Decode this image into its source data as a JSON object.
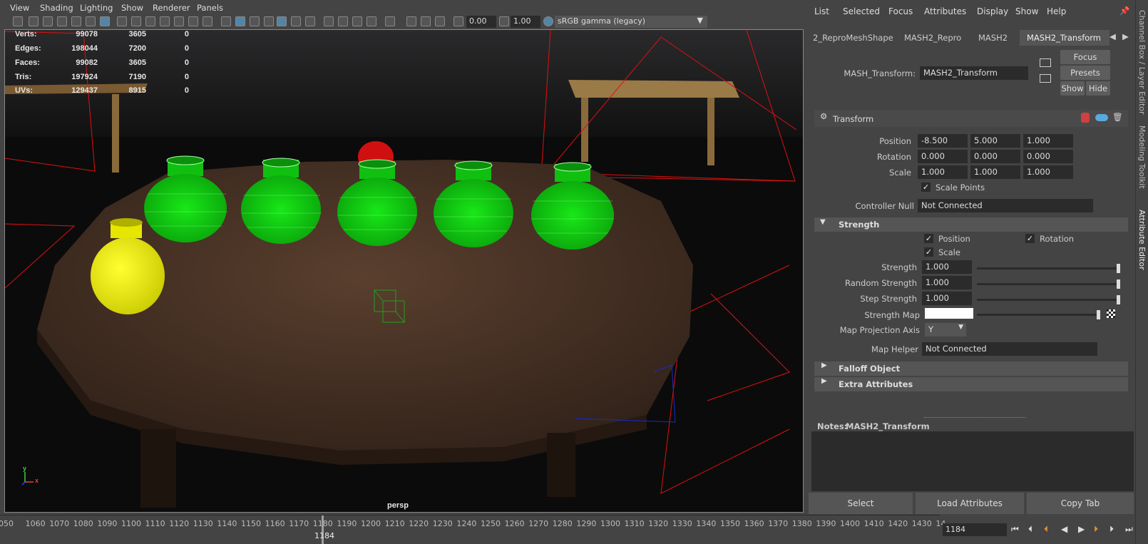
{
  "viewport_menu": [
    "View",
    "Shading",
    "Lighting",
    "Show",
    "Renderer",
    "Panels"
  ],
  "viewport_toolbar": {
    "exposure": "0.00",
    "gamma": "1.00",
    "color_space": "sRGB gamma (legacy)"
  },
  "hud": {
    "rows": [
      {
        "label": "Verts:",
        "a": "99078",
        "b": "3605",
        "c": "0"
      },
      {
        "label": "Edges:",
        "a": "198044",
        "b": "7200",
        "c": "0"
      },
      {
        "label": "Faces:",
        "a": "99082",
        "b": "3605",
        "c": "0"
      },
      {
        "label": "Tris:",
        "a": "197924",
        "b": "7190",
        "c": "0"
      },
      {
        "label": "UVs:",
        "a": "129437",
        "b": "8915",
        "c": "0"
      }
    ],
    "camera": "persp",
    "axis_x": "x",
    "axis_y": "y"
  },
  "timeline": {
    "ticks": [
      "050",
      "1060",
      "1070",
      "1080",
      "1090",
      "1100",
      "1110",
      "1120",
      "1130",
      "1140",
      "1150",
      "1160",
      "1170",
      "1180",
      "1190",
      "1200",
      "1210",
      "1220",
      "1230",
      "1240",
      "1250",
      "1260",
      "1270",
      "1280",
      "1290",
      "1300",
      "1310",
      "1320",
      "1330",
      "1340",
      "1350",
      "1360",
      "1370",
      "1380",
      "1390",
      "1400",
      "1410",
      "1420",
      "1430",
      "14"
    ],
    "current": "1184",
    "frame_field": "1184"
  },
  "ae": {
    "menu": [
      "List",
      "Selected",
      "Focus",
      "Attributes",
      "Display",
      "Show",
      "Help"
    ],
    "tabs": [
      "2_ReproMeshShape",
      "MASH2_Repro",
      "MASH2",
      "MASH2_Transform"
    ],
    "node_label": "MASH_Transform:",
    "node_value": "MASH2_Transform",
    "buttons": {
      "focus": "Focus",
      "presets": "Presets",
      "show": "Show",
      "hide": "Hide"
    },
    "transform_header": "Transform",
    "position_label": "Position",
    "position": [
      "-8.500",
      "5.000",
      "1.000"
    ],
    "rotation_label": "Rotation",
    "rotation": [
      "0.000",
      "0.000",
      "0.000"
    ],
    "scale_label": "Scale",
    "scale": [
      "1.000",
      "1.000",
      "1.000"
    ],
    "scale_points": "Scale Points",
    "controller_label": "Controller Null",
    "controller_value": "Not Connected",
    "strength_section": "Strength",
    "chk_position": "Position",
    "chk_rotation": "Rotation",
    "chk_scale": "Scale",
    "strength_label": "Strength",
    "strength": "1.000",
    "random_label": "Random Strength",
    "random": "1.000",
    "step_label": "Step Strength",
    "step": "1.000",
    "map_label": "Strength Map",
    "axis_label": "Map Projection Axis",
    "axis_value": "Y",
    "helper_label": "Map Helper",
    "helper_value": "Not Connected",
    "falloff": "Falloff Object",
    "extra": "Extra Attributes",
    "notes_label": "Notes:",
    "notes_value": "MASH2_Transform",
    "bottom": {
      "select": "Select",
      "load": "Load Attributes",
      "copy": "Copy Tab"
    }
  },
  "side_tabs": [
    "Channel Box / Layer Editor",
    "Modeling Toolkit",
    "Attribute Editor"
  ]
}
